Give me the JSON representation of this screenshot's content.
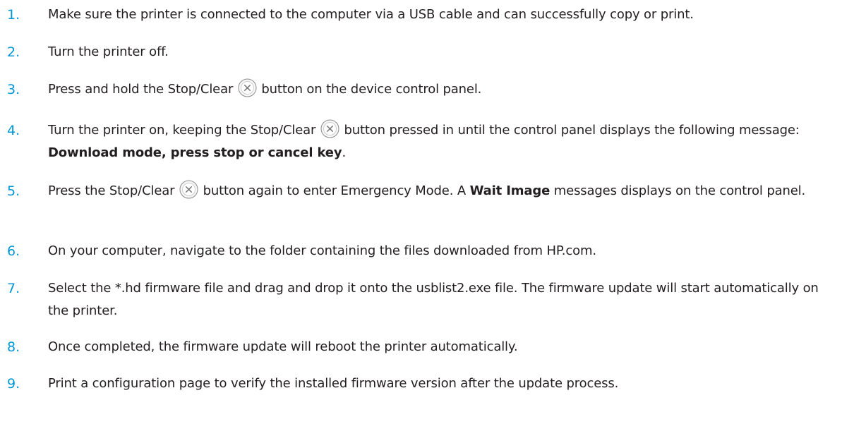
{
  "theme": {
    "accent": "#0096d6",
    "text": "#231f20"
  },
  "icons": {
    "stop_clear": "stop-clear-x-icon"
  },
  "steps": [
    {
      "num": "1.",
      "text": "Make sure the printer is connected to the computer via a USB cable and can successfully copy or print."
    },
    {
      "num": "2.",
      "text": "Turn the printer off."
    },
    {
      "num": "3.",
      "text_a": "Press and hold the Stop/Clear",
      "text_b": "button on the device control panel."
    },
    {
      "num": "4.",
      "text_a": "Turn the printer on, keeping the Stop/Clear",
      "text_b": "button pressed in until the control panel displays the following message:",
      "bold": "Download mode, press stop or cancel key",
      "text_c": "."
    },
    {
      "num": "5.",
      "text_a": "Press the Stop/Clear",
      "text_b": "button again to enter Emergency Mode. A",
      "bold": "Wait Image",
      "text_c": "messages displays on the control panel."
    },
    {
      "num": "6.",
      "text": "On your computer, navigate to the folder containing the files downloaded from HP.com."
    },
    {
      "num": "7.",
      "text": "Select the *.hd firmware file and drag and drop it onto the usblist2.exe file. The firmware update will start automatically on the printer."
    },
    {
      "num": "8.",
      "text": "Once completed, the firmware update will reboot the printer automatically."
    },
    {
      "num": "9.",
      "text": "Print a configuration page to verify the installed firmware version after the update process."
    }
  ]
}
